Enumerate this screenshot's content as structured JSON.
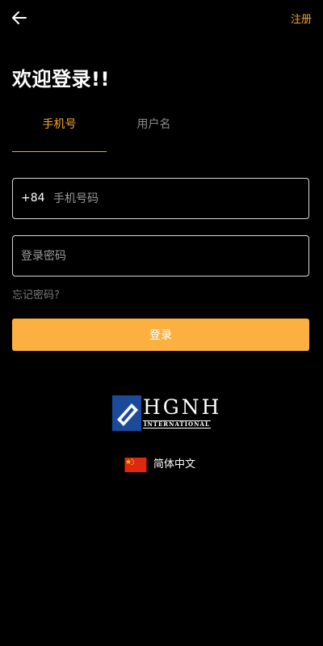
{
  "header": {
    "back_icon": "arrow-left-icon",
    "register_label": "注册"
  },
  "title": "欢迎登录!!",
  "tabs": [
    {
      "label": "手机号",
      "active": true
    },
    {
      "label": "用户名",
      "active": false
    }
  ],
  "phone": {
    "country_code": "+84",
    "placeholder": "手机号码",
    "value": ""
  },
  "password": {
    "placeholder": "登录密码",
    "value": ""
  },
  "forgot_label": "忘记密码?",
  "login_label": "登录",
  "logo": {
    "text": "HGNH",
    "subtext": "INTERNATIONAL"
  },
  "language": {
    "flag_icon": "china-flag-icon",
    "label": "简体中文"
  },
  "colors": {
    "background": "#000000",
    "accent": "#f5a623",
    "button": "#fbb040",
    "logo_blue": "#1c4a9a"
  }
}
